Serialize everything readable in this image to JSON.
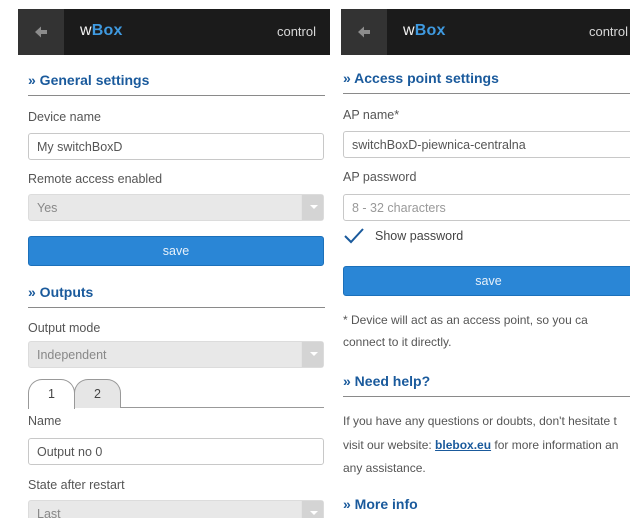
{
  "left": {
    "header": {
      "logo_w": "w",
      "logo_box": "Box",
      "control": "control"
    },
    "general": {
      "title": "» General settings",
      "device_name_label": "Device name",
      "device_name_value": "My switchBoxD",
      "remote_label": "Remote access enabled",
      "remote_value": "Yes",
      "save": "save"
    },
    "outputs": {
      "title": "» Outputs",
      "mode_label": "Output mode",
      "mode_value": "Independent",
      "tabs": [
        "1",
        "2"
      ],
      "name_label": "Name",
      "name_value": "Output no 0",
      "state_label": "State after restart",
      "state_value": "Last"
    }
  },
  "right": {
    "header": {
      "logo_w": "w",
      "logo_box": "Box",
      "control": "control"
    },
    "ap": {
      "title": "» Access point settings",
      "name_label": "AP name*",
      "name_value": "switchBoxD-piewnica-centralna",
      "password_label": "AP password",
      "password_placeholder": "8 - 32 characters",
      "show_password": "Show password",
      "save": "save",
      "note_line1": "* Device will act as an access point, so you ca",
      "note_line2": "connect to it directly."
    },
    "help": {
      "title": "» Need help?",
      "line1": "If you have any questions or doubts, don't hesitate t",
      "line2_pre": "visit our website: ",
      "link": "blebox.eu",
      "line2_post": " for more information an",
      "line3": "any assistance."
    },
    "more": {
      "title": "» More info"
    }
  },
  "colors": {
    "accent": "#2a86d6",
    "section_title": "#1a5a9c",
    "header_bg": "#1b1b1b",
    "logo_box": "#3f9ae0"
  }
}
